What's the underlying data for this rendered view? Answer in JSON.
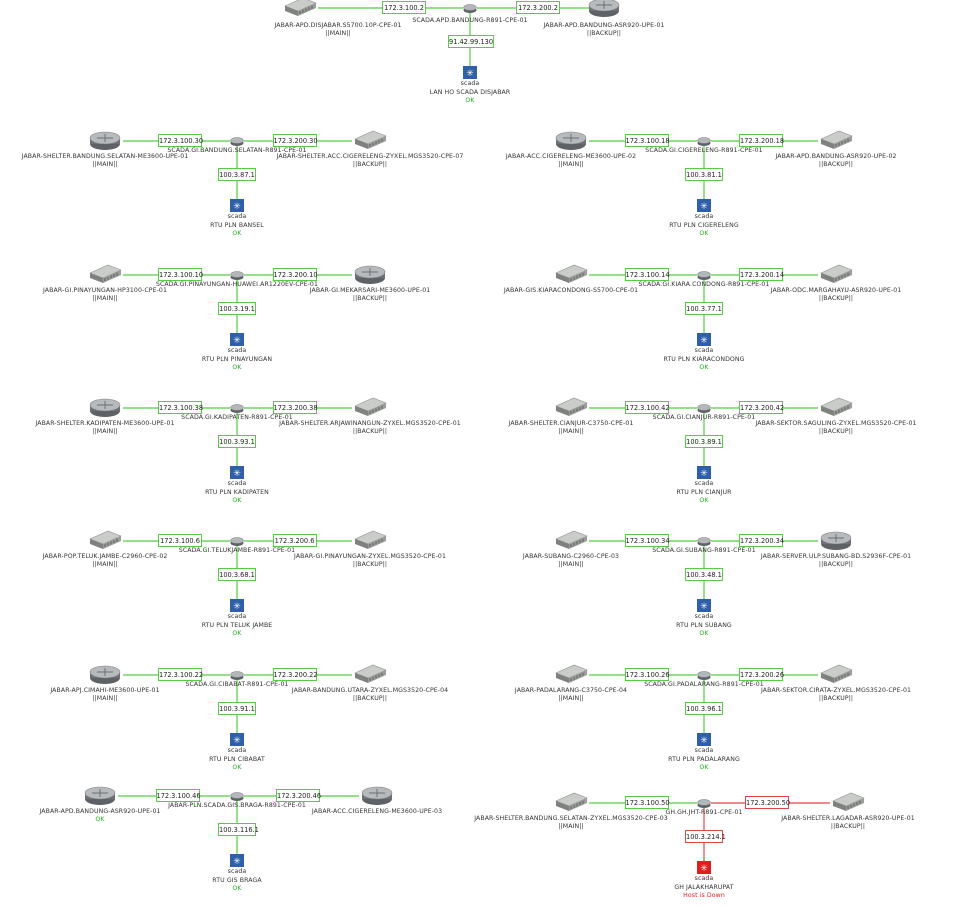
{
  "icons": {
    "router": "router-icon",
    "switch": "switch-icon",
    "hub": "hub-router-icon",
    "scada": "scada-icon"
  },
  "colors": {
    "link_ok": "#55cc44",
    "link_down": "#e04444",
    "scada_ok": "#2f5fa8",
    "scada_down": "#e21d1d",
    "status_ok": "#1fb31f",
    "status_down": "#e02020"
  },
  "top": {
    "main_ip": "172.3.100.2",
    "backup_ip": "172.3.200.2",
    "hub_name": "SCADA.APD.BANDUNG-R891-CPE-01",
    "left_name": "JABAR-APD.DISJABAR.S5700.10P-CPE-01",
    "left_tag": "||MAIN||",
    "right_name": "JABAR-APD.BANDUNG-ASR920-UPE-01",
    "right_tag": "||BACKUP||",
    "down_ip": "91.42.99.130",
    "scada_text": "scada",
    "node_name": "LAN HO SCADA DISJABAR",
    "status": "OK"
  },
  "groups": [
    {
      "id": "bansel",
      "main_ip": "172.3.100.30",
      "backup_ip": "172.3.200.30",
      "hub_name": "SCADA.GI.BANDUNG.SELATAN-R891-CPE-01",
      "left_name": "JABAR-SHELTER.BANDUNG.SELATAN-ME3600-UPE-01",
      "left_tag": "||MAIN||",
      "right_name": "JABAR-SHELTER.ACC.CIGERELENG-ZYXEL.MGS3520-CPE-07",
      "right_tag": "||BACKUP||",
      "down_ip": "100.3.87.1",
      "scada_text": "scada",
      "node_name": "RTU PLN BANSEL",
      "status": "OK"
    },
    {
      "id": "cigereleng",
      "main_ip": "172.3.100.18",
      "backup_ip": "172.3.200.18",
      "hub_name": "SCADA.GI.CIGERELENG-R891-CPE-01",
      "left_name": "JABAR-ACC.CIGERELENG-ME3600-UPE-02",
      "left_tag": "||MAIN||",
      "right_name": "JABAR-APD.BANDUNG-ASR920-UPE-02",
      "right_tag": "||BACKUP||",
      "down_ip": "100.3.81.1",
      "scada_text": "scada",
      "node_name": "RTU PLN CIGERELENG",
      "status": "OK"
    },
    {
      "id": "pinayungan",
      "main_ip": "172.3.100.10",
      "backup_ip": "172.3.200.10",
      "hub_name": "SCADA.GI.PINAYUNGAN-HUAWEI.AR1220EV-CPE-01",
      "left_name": "JABAR-GI.PINAYUNGAN-HP3100-CPE-01",
      "left_tag": "||MAIN||",
      "right_name": "JABAR-GI.MEKARSARI-ME3600-UPE-01",
      "right_tag": "||BACKUP||",
      "down_ip": "100.3.19.1",
      "scada_text": "scada",
      "node_name": "RTU PLN PINAYUNGAN",
      "status": "OK"
    },
    {
      "id": "kiaracondong",
      "main_ip": "172.3.100.14",
      "backup_ip": "172.3.200.14",
      "hub_name": "SCADA.GI.KIARA.CONDONG-R891-CPE-01",
      "left_name": "JABAR-GIS.KIARACONDONG-S5700-CPE-01",
      "left_tag": "",
      "right_name": "JABAR-ODC.MARGAHAYU-ASR920-UPE-01",
      "right_tag": "||BACKUP||",
      "down_ip": "100.3.77.1",
      "scada_text": "scada",
      "node_name": "RTU PLN KIARACONDONG",
      "status": "OK"
    },
    {
      "id": "kadipaten",
      "main_ip": "172.3.100.38",
      "backup_ip": "172.3.200.38",
      "hub_name": "SCADA.GI.KADIPATEN-R891-CPE-01",
      "left_name": "JABAR-SHELTER.KADIPATEN-ME3600-UPE-01",
      "left_tag": "||MAIN||",
      "right_name": "JABAR-SHELTER.ARJAWINANGUN-ZYXEL.MGS3520-CPE-01",
      "right_tag": "||BACKUP||",
      "down_ip": "100.3.93.1",
      "scada_text": "scada",
      "node_name": "RTU PLN KADIPATEN",
      "status": "OK"
    },
    {
      "id": "cianjur",
      "main_ip": "172.3.100.42",
      "backup_ip": "172.3.200.42",
      "hub_name": "SCADA.GI.CIANJUR-R891-CPE-01",
      "left_name": "JABAR-SHELTER.CIANJUR-C3750-CPE-01",
      "left_tag": "||MAIN||",
      "right_name": "JABAR-SEKTOR.SAGULING-ZYXEL.MGS3520-CPE-01",
      "right_tag": "||BACKUP||",
      "down_ip": "100.3.89.1",
      "scada_text": "scada",
      "node_name": "RTU PLN CIANJUR",
      "status": "OK"
    },
    {
      "id": "telukjambe",
      "main_ip": "172.3.100.6",
      "backup_ip": "172.3.200.6",
      "hub_name": "SCADA.GI.TELUKJAMBE-R891-CPE-01",
      "left_name": "JABAR-POP.TELUK.JAMBE-C2960-CPE-02",
      "left_tag": "||MAIN||",
      "right_name": "JABAR-GI.PINAYUNGAN-ZYXEL.MGS3520-CPE-01",
      "right_tag": "||BACKUP||",
      "down_ip": "100.3.68.1",
      "scada_text": "scada",
      "node_name": "RTU PLN TELUK JAMBE",
      "status": "OK"
    },
    {
      "id": "subang",
      "main_ip": "172.3.100.34",
      "backup_ip": "172.3.200.34",
      "hub_name": "SCADA.GI.SUBANG-R891-CPE-01",
      "left_name": "JABAR-SUBANG-C2960-CPE-03",
      "left_tag": "||MAIN||",
      "right_name": "JABAR-SERVER.ULP.SUBANG-BD.S2936F-CPE-01",
      "right_tag": "||BACKUP||",
      "down_ip": "100.3.48.1",
      "scada_text": "scada",
      "node_name": "RTU PLN SUBANG",
      "status": "OK"
    },
    {
      "id": "cibabat",
      "main_ip": "172.3.100.22",
      "backup_ip": "172.3.200.22",
      "hub_name": "SCADA.GI.CIBABAT-R891-CPE-01",
      "left_name": "JABAR-APJ.CIMAHI-ME3600-UPE-01",
      "left_tag": "||MAIN||",
      "right_name": "JABAR-BANDUNG.UTARA-ZYXEL.MGS3520-CPE-04",
      "right_tag": "||BACKUP||",
      "down_ip": "100.3.91.1",
      "scada_text": "scada",
      "node_name": "RTU PLN CIBABAT",
      "status": "OK"
    },
    {
      "id": "padalarang",
      "main_ip": "172.3.100.26",
      "backup_ip": "172.3.200.26",
      "hub_name": "SCADA.GI.PADALARANG-R891-CPE-01",
      "left_name": "JABAR-PADALARANG-C3750-CPE-04",
      "left_tag": "||MAIN||",
      "right_name": "JABAR-SEKTOR.CIRATA-ZYXEL.MGS3520-CPE-01",
      "right_tag": "||BACKUP||",
      "down_ip": "100.3.96.1",
      "scada_text": "scada",
      "node_name": "RTU PLN PADALARANG",
      "status": "OK"
    },
    {
      "id": "braga",
      "main_ip": "172.3.100.46",
      "backup_ip": "172.3.200.46",
      "hub_name": "JABAR-PLN.SCADA.GIS.BRAGA-R891-CPE-01",
      "left_name": "JABAR-APD.BANDUNG-ASR920-UPE-01",
      "left_tag": "OK",
      "right_name": "JABAR-ACC.CIGERELENG-ME3600-UPE-03",
      "right_tag": "",
      "down_ip": "100.3.116.1",
      "scada_text": "scada",
      "node_name": "RTU GIS BRAGA",
      "status": "OK"
    },
    {
      "id": "jalakharupat",
      "main_ip": "172.3.100.50",
      "backup_ip": "172.3.200.50",
      "hub_name": "GH.GH.JHT-R891-CPE-01",
      "left_name": "JABAR-SHELTER.BANDUNG.SELATAN-ZYXEL.MGS3520-CPE-03",
      "left_tag": "||MAIN||",
      "right_name": "JABAR-SHELTER.LAGADAR-ASR920-UPE-01",
      "right_tag": "||BACKUP||",
      "down_ip": "100.3.214.1",
      "scada_text": "scada",
      "node_name": "GH JALAKHARUPAT",
      "status": "Host is Down"
    }
  ]
}
